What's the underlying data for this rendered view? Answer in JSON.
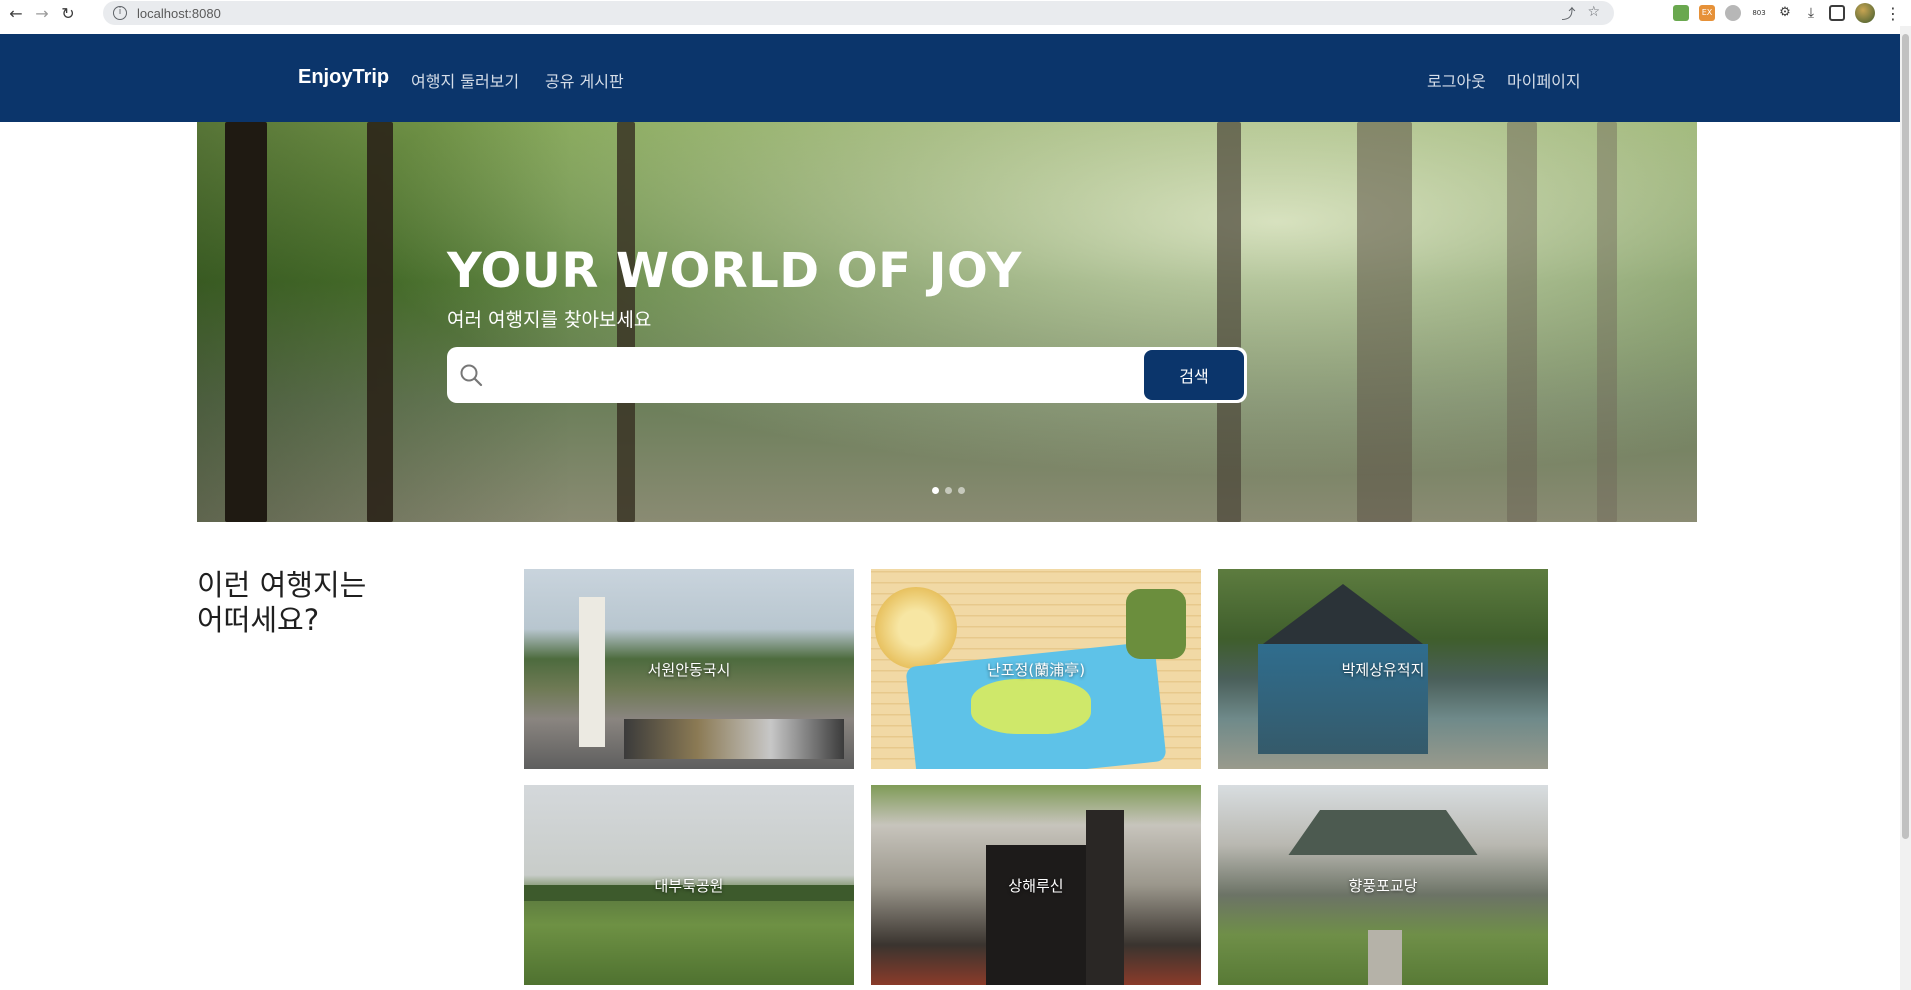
{
  "browser": {
    "url": "localhost:8080",
    "extensions": [
      "ext-green",
      "ext-ex",
      "ext-gray",
      "ext-803",
      "puzzle",
      "download",
      "sidepanel",
      "profile"
    ]
  },
  "navbar": {
    "brand": "EnjoyTrip",
    "left_links": [
      "여행지 둘러보기",
      "공유 게시판"
    ],
    "right_links": [
      "로그아웃",
      "마이페이지"
    ],
    "bg_color": "#0b356b"
  },
  "hero": {
    "title": "YOUR WORLD OF JOY",
    "subtitle": "여러 여행지를 찾아보세요",
    "search": {
      "value": "",
      "placeholder": "",
      "button_label": "검색"
    },
    "carousel_slides": 3,
    "active_slide": 1
  },
  "recommend": {
    "title": "이런 여행지는\n어떠세요?",
    "cards": [
      {
        "label": "서원안동국시"
      },
      {
        "label": "난포정(蘭浦亭)"
      },
      {
        "label": "박제상유적지"
      },
      {
        "label": "대부둑공원"
      },
      {
        "label": "상해루신"
      },
      {
        "label": "향풍포교당"
      }
    ]
  }
}
